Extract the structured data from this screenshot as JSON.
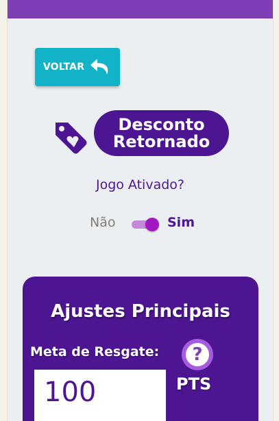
{
  "header": {
    "bar_color": "#7e3fb6"
  },
  "back_button": {
    "label": "VOLTAR",
    "icon": "undo-arrow-icon"
  },
  "title": {
    "line1": "Desconto",
    "line2": "Retornado",
    "icon": "tag-heart-icon"
  },
  "game_toggle": {
    "question": "Jogo Ativado?",
    "off_label": "Não",
    "on_label": "Sim",
    "state": "on"
  },
  "panel": {
    "title": "Ajustes Principais",
    "meta_label": "Meta de Resgate:",
    "help_icon": "question-icon",
    "meta_value": "100",
    "unit": "PTS"
  },
  "colors": {
    "primary": "#4d1591",
    "accent": "#7e3fb6",
    "button": "#12b3c8",
    "background": "#eceff1"
  }
}
